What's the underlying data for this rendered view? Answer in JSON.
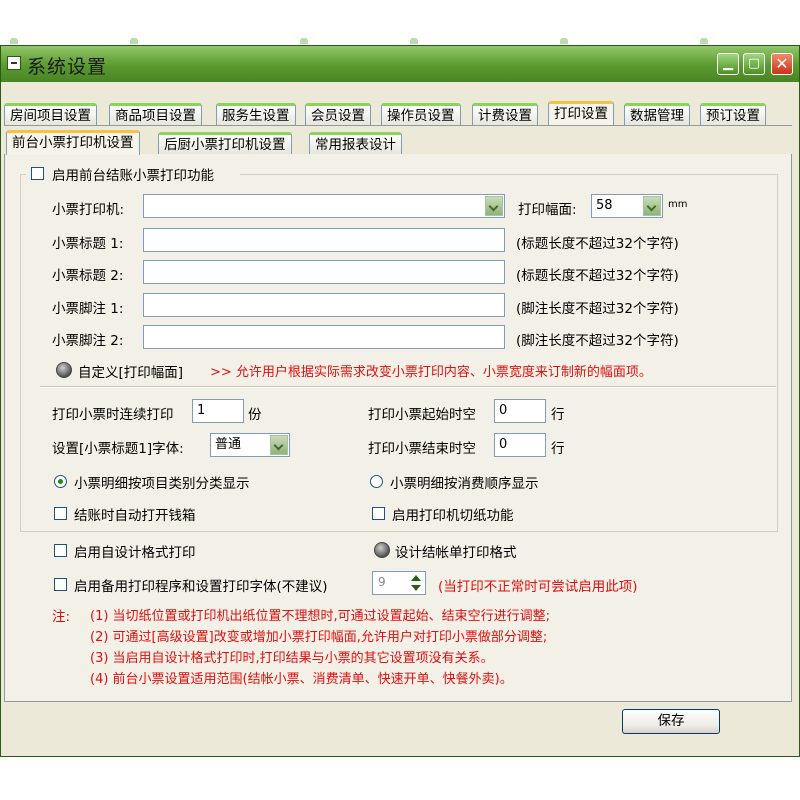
{
  "window": {
    "title": "系统设置",
    "min_label": "▁",
    "max_label": "▢",
    "close_label": "✕"
  },
  "tabs_main": [
    {
      "label": "房间项目设置"
    },
    {
      "label": "商品项目设置"
    },
    {
      "label": "服务生设置"
    },
    {
      "label": "会员设置"
    },
    {
      "label": "操作员设置"
    },
    {
      "label": "计费设置"
    },
    {
      "label": "打印设置"
    },
    {
      "label": "数据管理"
    },
    {
      "label": "预订设置"
    }
  ],
  "tabs_sub": [
    {
      "label": "前台小票打印机设置"
    },
    {
      "label": "后厨小票打印机设置"
    },
    {
      "label": "常用报表设计"
    }
  ],
  "enable_front": "启用前台结账小票打印功能",
  "fields": {
    "printer_label": "小票打印机:",
    "width_label": "打印幅面:",
    "width_value": "58",
    "width_unit": "mm",
    "title1_label": "小票标题 1:",
    "title1_hint": "(标题长度不超过32个字符)",
    "title2_label": "小票标题 2:",
    "title2_hint": "(标题长度不超过32个字符)",
    "footer1_label": "小票脚注 1:",
    "footer1_hint": "(脚注长度不超过32个字符)",
    "footer2_label": "小票脚注 2:",
    "footer2_hint": "(脚注长度不超过32个字符)"
  },
  "custom_width": {
    "label": "自定义[打印幅面]",
    "desc": ">> 允许用户根据实际需求改变小票打印内容、小票宽度来订制新的幅面项。"
  },
  "options": {
    "copies_label": "打印小票时连续打印",
    "copies_value": "1",
    "copies_unit": "份",
    "start_blank_label": "打印小票起始时空",
    "start_blank_value": "0",
    "start_blank_unit": "行",
    "font_label": "设置[小票标题1]字体:",
    "font_value": "普通",
    "end_blank_label": "打印小票结束时空",
    "end_blank_value": "0",
    "end_blank_unit": "行",
    "radio_by_category": "小票明细按项目类别分类显示",
    "radio_by_order": "小票明细按消费顺序显示",
    "cashbox": "结账时自动打开钱箱",
    "cutter": "启用打印机切纸功能",
    "custom_format": "启用自设计格式打印",
    "design_bill": "设计结帐单打印格式",
    "backup_print": "启用备用打印程序和设置打印字体(不建议)",
    "backup_font_size": "9",
    "backup_hint": "(当打印不正常时可尝试启用此项)"
  },
  "notes": {
    "prefix": "注:",
    "lines": [
      "(1) 当切纸位置或打印机出纸位置不理想时,可通过设置起始、结束空行进行调整;",
      "(2) 可通过[高级设置]改变或增加小票打印幅面,允许用户对打印小票做部分调整;",
      "(3) 当启用自设计格式打印时,打印结果与小票的其它设置项没有关系。",
      "(4) 前台小票设置适用范围(结帐小票、消费清单、快速开单、快餐外卖)。"
    ]
  },
  "save_label": "保存",
  "colors": {
    "title_bar": "#5a9a2e",
    "tab_active_top": "#f5c242",
    "tab_top": "#8bd35a",
    "note_red": "#e01010"
  }
}
